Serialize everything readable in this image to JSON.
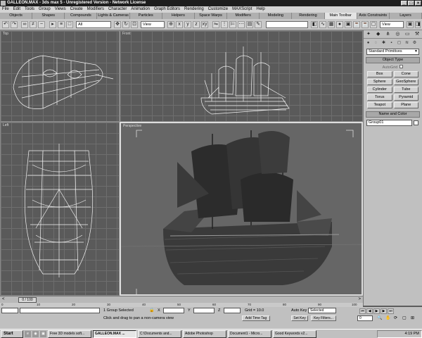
{
  "window": {
    "title": "GALLEON.MAX - 3ds max 5 - Unregistered Version - Network License"
  },
  "menu": [
    "File",
    "Edit",
    "Tools",
    "Group",
    "Views",
    "Create",
    "Modifiers",
    "Character",
    "Animation",
    "Graph Editors",
    "Rendering",
    "Customize",
    "MAXScript",
    "Help"
  ],
  "tabs": [
    "Objects",
    "Shapes",
    "Compounds",
    "Lights & Cameras",
    "Particles",
    "Helpers",
    "Space Warps",
    "Modifiers",
    "Modeling",
    "Rendering",
    "Main Toolbar",
    "Axis Constraints",
    "Layers"
  ],
  "active_tab": "Main Toolbar",
  "toolbar": {
    "selection_filter": "All",
    "ref_coord": "View",
    "named_set": "",
    "view_dropdown": "View"
  },
  "viewports": {
    "top": "Top",
    "front": "Front",
    "left": "Left",
    "perspective": "Perspective"
  },
  "command_panel": {
    "category": "Standard Primitives",
    "object_type_title": "Object Type",
    "autogrid": "AutoGrid",
    "buttons": [
      "Box",
      "Cone",
      "Sphere",
      "GeoSphere",
      "Cylinder",
      "Tube",
      "Torus",
      "Pyramid",
      "Teapot",
      "Plane"
    ],
    "name_color_title": "Name and Color",
    "object_name": "Group01"
  },
  "timeline": {
    "slider": "0 / 100",
    "ticks": [
      "0",
      "10",
      "20",
      "30",
      "40",
      "50",
      "60",
      "70",
      "80",
      "90",
      "100"
    ]
  },
  "status": {
    "selection": "1 Group Selected",
    "prompt": "Click and drag to pan a non-camera view",
    "x_label": "X",
    "y_label": "Y",
    "z_label": "Z",
    "grid": "Grid = 10.0",
    "add_time_tag": "Add Time Tag",
    "auto_key": "Auto Key",
    "key_mode": "Selected",
    "set_key": "Set Key",
    "key_filters": "Key Filters...",
    "frame": "0",
    "maxscript": "MaxScript"
  },
  "taskbar": {
    "start": "Start",
    "tasks": [
      "Free 3D models soft...",
      "GALLEON.MAX ...",
      "C:\\Documents and...",
      "Adobe Photoshop",
      "Document1 - Micro...",
      "Good Keywords v2..."
    ],
    "active_task": "GALLEON.MAX ...",
    "clock": "4:19 PM"
  }
}
